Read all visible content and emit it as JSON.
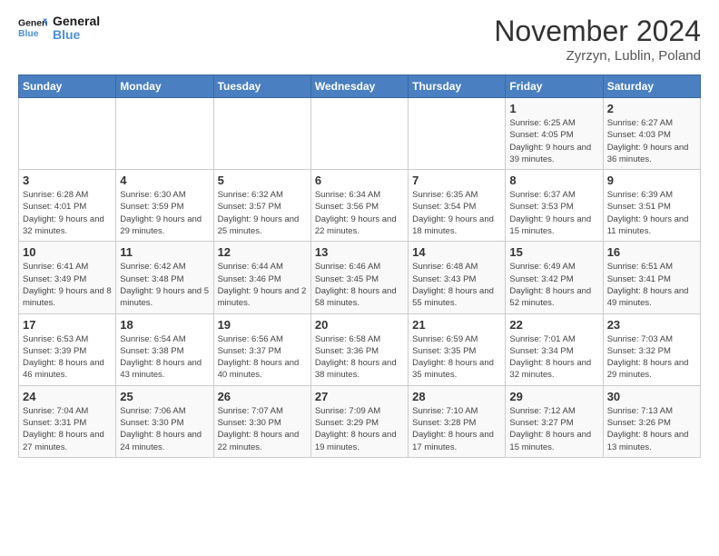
{
  "logo": {
    "line1": "General",
    "line2": "Blue"
  },
  "title": "November 2024",
  "location": "Zyrzyn, Lublin, Poland",
  "headers": [
    "Sunday",
    "Monday",
    "Tuesday",
    "Wednesday",
    "Thursday",
    "Friday",
    "Saturday"
  ],
  "weeks": [
    [
      {
        "day": "",
        "info": ""
      },
      {
        "day": "",
        "info": ""
      },
      {
        "day": "",
        "info": ""
      },
      {
        "day": "",
        "info": ""
      },
      {
        "day": "",
        "info": ""
      },
      {
        "day": "1",
        "info": "Sunrise: 6:25 AM\nSunset: 4:05 PM\nDaylight: 9 hours and 39 minutes."
      },
      {
        "day": "2",
        "info": "Sunrise: 6:27 AM\nSunset: 4:03 PM\nDaylight: 9 hours and 36 minutes."
      }
    ],
    [
      {
        "day": "3",
        "info": "Sunrise: 6:28 AM\nSunset: 4:01 PM\nDaylight: 9 hours and 32 minutes."
      },
      {
        "day": "4",
        "info": "Sunrise: 6:30 AM\nSunset: 3:59 PM\nDaylight: 9 hours and 29 minutes."
      },
      {
        "day": "5",
        "info": "Sunrise: 6:32 AM\nSunset: 3:57 PM\nDaylight: 9 hours and 25 minutes."
      },
      {
        "day": "6",
        "info": "Sunrise: 6:34 AM\nSunset: 3:56 PM\nDaylight: 9 hours and 22 minutes."
      },
      {
        "day": "7",
        "info": "Sunrise: 6:35 AM\nSunset: 3:54 PM\nDaylight: 9 hours and 18 minutes."
      },
      {
        "day": "8",
        "info": "Sunrise: 6:37 AM\nSunset: 3:53 PM\nDaylight: 9 hours and 15 minutes."
      },
      {
        "day": "9",
        "info": "Sunrise: 6:39 AM\nSunset: 3:51 PM\nDaylight: 9 hours and 11 minutes."
      }
    ],
    [
      {
        "day": "10",
        "info": "Sunrise: 6:41 AM\nSunset: 3:49 PM\nDaylight: 9 hours and 8 minutes."
      },
      {
        "day": "11",
        "info": "Sunrise: 6:42 AM\nSunset: 3:48 PM\nDaylight: 9 hours and 5 minutes."
      },
      {
        "day": "12",
        "info": "Sunrise: 6:44 AM\nSunset: 3:46 PM\nDaylight: 9 hours and 2 minutes."
      },
      {
        "day": "13",
        "info": "Sunrise: 6:46 AM\nSunset: 3:45 PM\nDaylight: 8 hours and 58 minutes."
      },
      {
        "day": "14",
        "info": "Sunrise: 6:48 AM\nSunset: 3:43 PM\nDaylight: 8 hours and 55 minutes."
      },
      {
        "day": "15",
        "info": "Sunrise: 6:49 AM\nSunset: 3:42 PM\nDaylight: 8 hours and 52 minutes."
      },
      {
        "day": "16",
        "info": "Sunrise: 6:51 AM\nSunset: 3:41 PM\nDaylight: 8 hours and 49 minutes."
      }
    ],
    [
      {
        "day": "17",
        "info": "Sunrise: 6:53 AM\nSunset: 3:39 PM\nDaylight: 8 hours and 46 minutes."
      },
      {
        "day": "18",
        "info": "Sunrise: 6:54 AM\nSunset: 3:38 PM\nDaylight: 8 hours and 43 minutes."
      },
      {
        "day": "19",
        "info": "Sunrise: 6:56 AM\nSunset: 3:37 PM\nDaylight: 8 hours and 40 minutes."
      },
      {
        "day": "20",
        "info": "Sunrise: 6:58 AM\nSunset: 3:36 PM\nDaylight: 8 hours and 38 minutes."
      },
      {
        "day": "21",
        "info": "Sunrise: 6:59 AM\nSunset: 3:35 PM\nDaylight: 8 hours and 35 minutes."
      },
      {
        "day": "22",
        "info": "Sunrise: 7:01 AM\nSunset: 3:34 PM\nDaylight: 8 hours and 32 minutes."
      },
      {
        "day": "23",
        "info": "Sunrise: 7:03 AM\nSunset: 3:32 PM\nDaylight: 8 hours and 29 minutes."
      }
    ],
    [
      {
        "day": "24",
        "info": "Sunrise: 7:04 AM\nSunset: 3:31 PM\nDaylight: 8 hours and 27 minutes."
      },
      {
        "day": "25",
        "info": "Sunrise: 7:06 AM\nSunset: 3:30 PM\nDaylight: 8 hours and 24 minutes."
      },
      {
        "day": "26",
        "info": "Sunrise: 7:07 AM\nSunset: 3:30 PM\nDaylight: 8 hours and 22 minutes."
      },
      {
        "day": "27",
        "info": "Sunrise: 7:09 AM\nSunset: 3:29 PM\nDaylight: 8 hours and 19 minutes."
      },
      {
        "day": "28",
        "info": "Sunrise: 7:10 AM\nSunset: 3:28 PM\nDaylight: 8 hours and 17 minutes."
      },
      {
        "day": "29",
        "info": "Sunrise: 7:12 AM\nSunset: 3:27 PM\nDaylight: 8 hours and 15 minutes."
      },
      {
        "day": "30",
        "info": "Sunrise: 7:13 AM\nSunset: 3:26 PM\nDaylight: 8 hours and 13 minutes."
      }
    ]
  ]
}
